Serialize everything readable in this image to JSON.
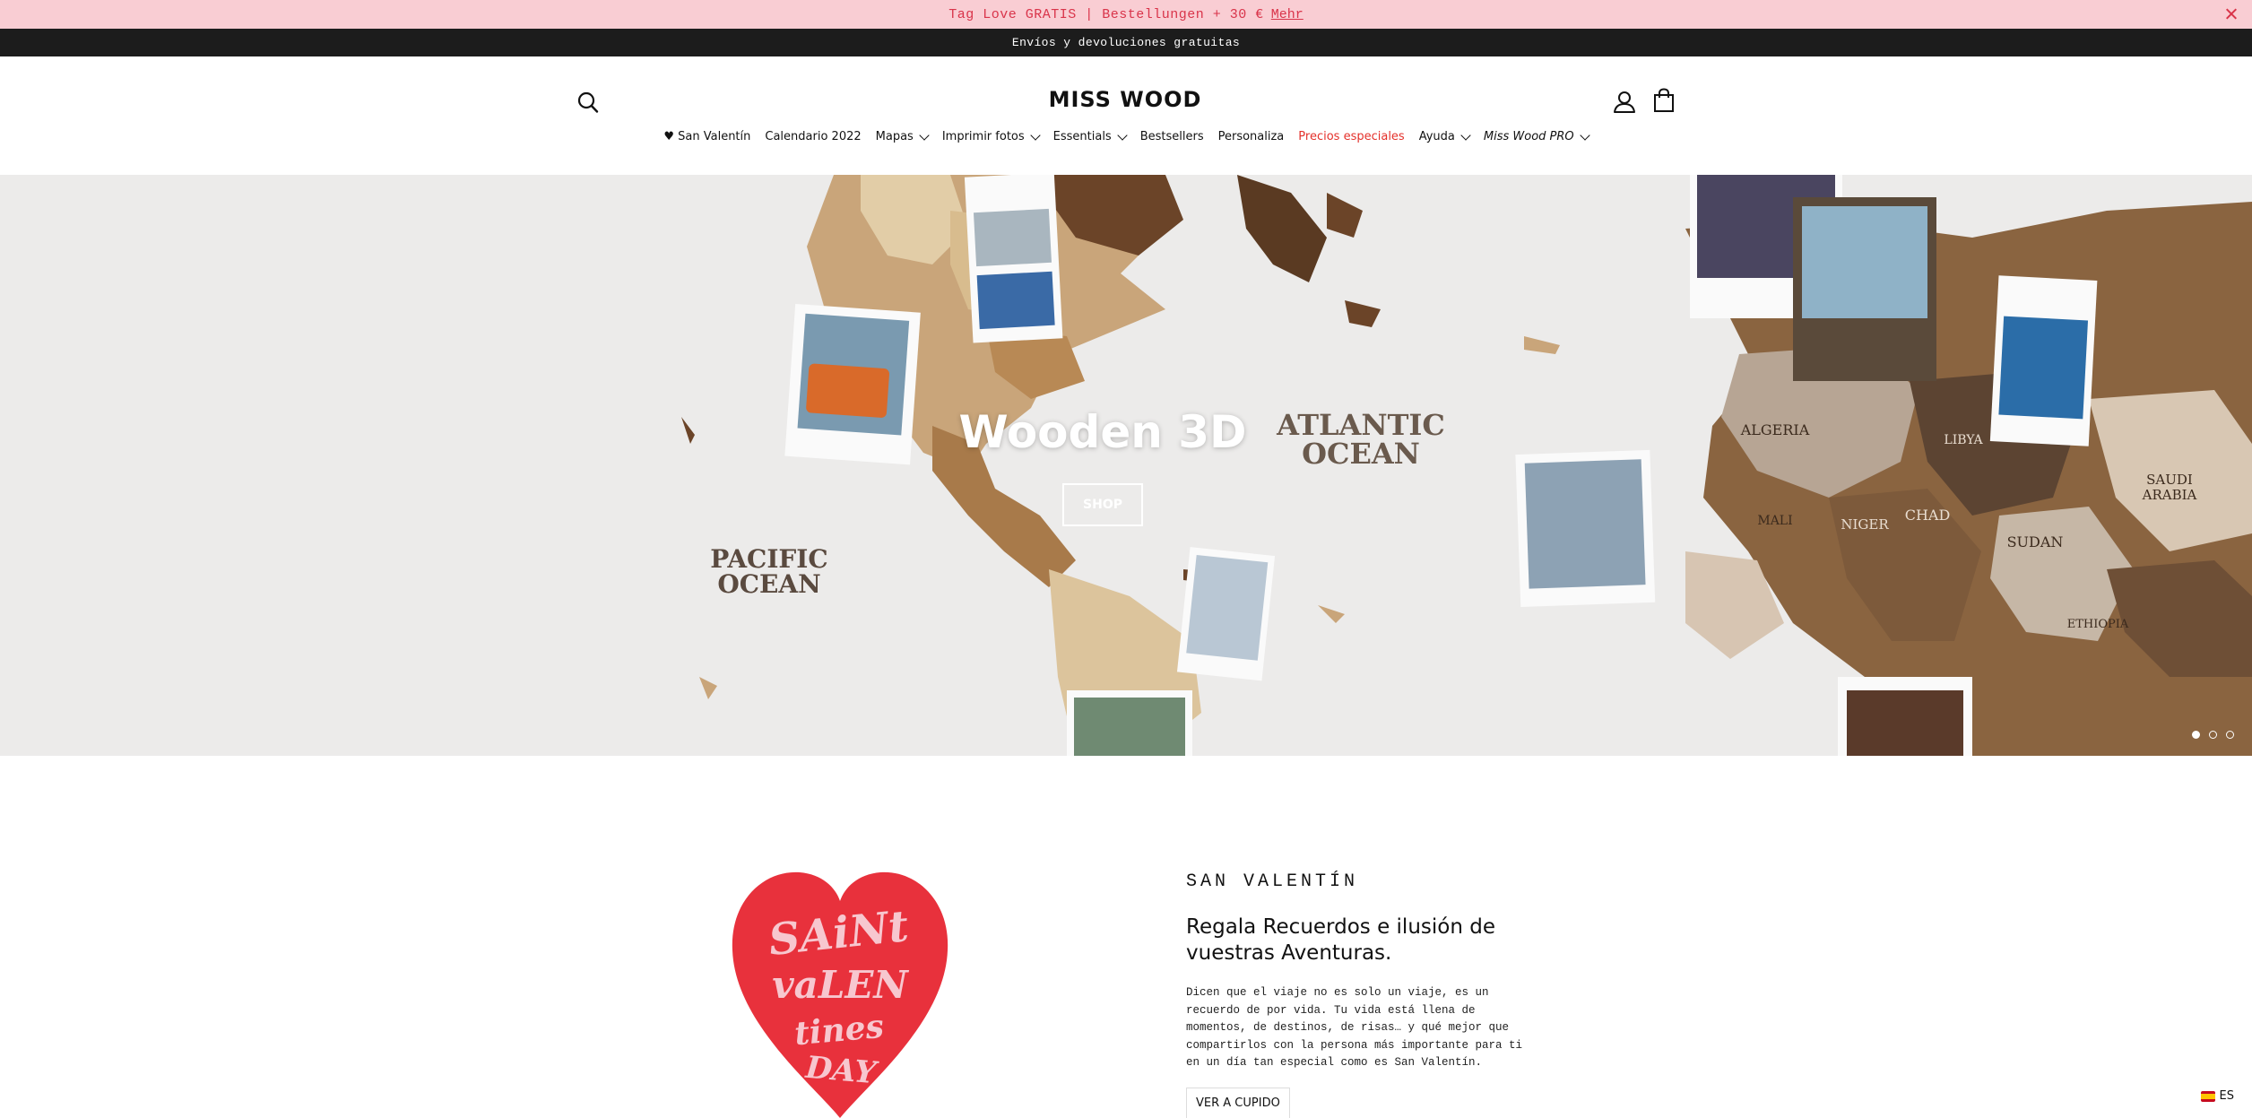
{
  "promo": {
    "text": "Tag Love GRATIS | Bestellungen + 30 €",
    "link": "Mehr"
  },
  "infobar": {
    "text": "Envíos y devoluciones gratuitas"
  },
  "header": {
    "logo": "MISS WOOD",
    "nav": [
      {
        "label": "♥ San Valentín",
        "dropdown": false
      },
      {
        "label": "Calendario 2022",
        "dropdown": false
      },
      {
        "label": "Mapas",
        "dropdown": true
      },
      {
        "label": "Imprimir fotos",
        "dropdown": true
      },
      {
        "label": "Essentials",
        "dropdown": true
      },
      {
        "label": "Bestsellers",
        "dropdown": false
      },
      {
        "label": "Personaliza",
        "dropdown": false
      },
      {
        "label": "Precios especiales",
        "dropdown": false
      },
      {
        "label": "Ayuda",
        "dropdown": true
      },
      {
        "label": "Miss Wood PRO",
        "dropdown": true
      }
    ]
  },
  "hero": {
    "title": "Wooden 3D",
    "button": "SHOP",
    "slides_total": 3,
    "active_slide": 1
  },
  "section": {
    "kicker": "SAN VALENTÍN",
    "heading": "Regala Recuerdos e ilusión de vuestras Aventuras.",
    "body": "Dicen que el viaje no es solo un viaje, es un recuerdo de por vida. Tu vida está llena de momentos, de destinos, de risas… y qué mejor que compartirlos con la persona más importante para ti en un día tan especial como es San Valentín.",
    "cta": "VER A CUPIDO"
  },
  "locale": {
    "label": "ES"
  },
  "colors": {
    "promo_bg": "#f9cdd3",
    "promo_text": "#d9344a",
    "infobar_bg": "#1c1c1c",
    "accent_red": "#e4312b",
    "heart_red": "#e8313c"
  }
}
